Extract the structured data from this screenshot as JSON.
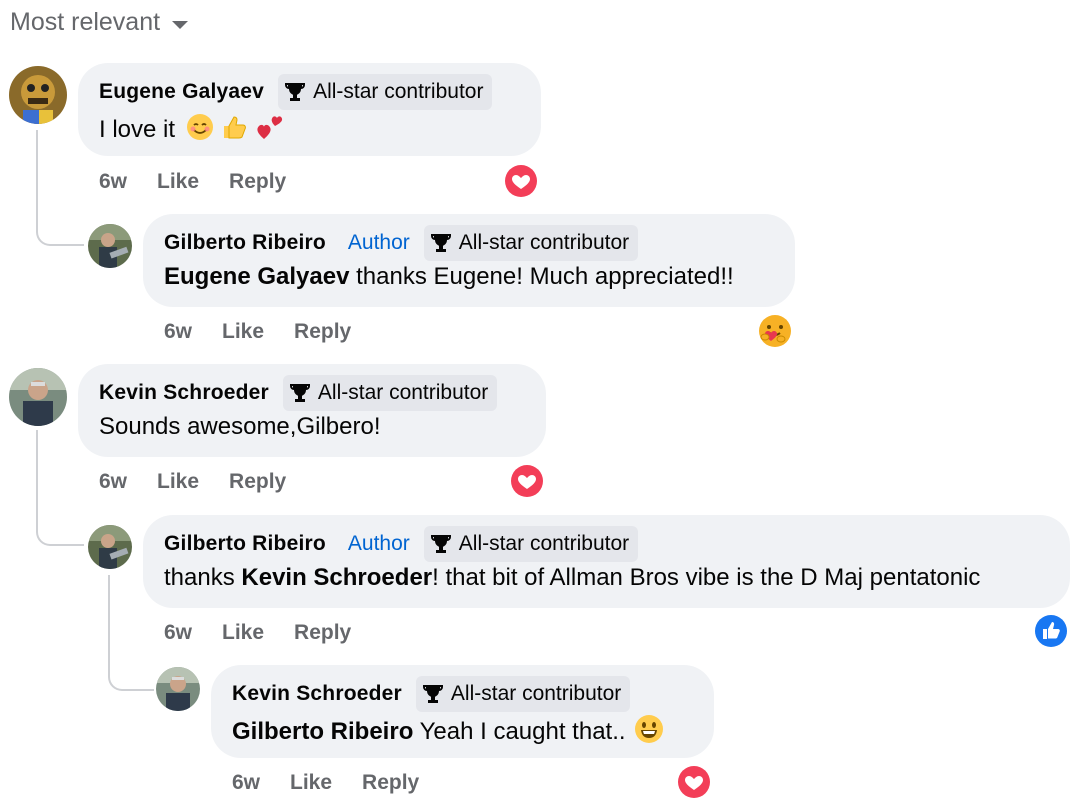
{
  "sort": {
    "label": "Most relevant"
  },
  "comments": [
    {
      "author": "Eugene Galyaev",
      "badge": "All-star contributor",
      "text": "I love it",
      "emojis": [
        "smiling-face-icon",
        "thumbs-up-icon",
        "two-hearts-icon"
      ],
      "time": "6w",
      "like": "Like",
      "reply": "Reply",
      "reaction": "heart-reaction-icon"
    },
    {
      "author": "Gilberto Ribeiro",
      "author_tag": "Author",
      "badge": "All-star contributor",
      "mention": "Eugene Galyaev",
      "text": " thanks Eugene! Much appreciated!!",
      "time": "6w",
      "like": "Like",
      "reply": "Reply",
      "reaction": "hug-reaction-icon"
    },
    {
      "author": "Kevin Schroeder",
      "badge": "All-star contributor",
      "text": "Sounds awesome,Gilbero!",
      "time": "6w",
      "like": "Like",
      "reply": "Reply",
      "reaction": "heart-reaction-icon"
    },
    {
      "author": "Gilberto Ribeiro",
      "author_tag": "Author",
      "badge": "All-star contributor",
      "text_before": "thanks ",
      "mention": "Kevin Schroeder",
      "text": "! that bit of Allman Bros vibe is the D Maj pentatonic",
      "time": "6w",
      "like": "Like",
      "reply": "Reply",
      "reaction": "like-reaction-icon"
    },
    {
      "author": "Kevin Schroeder",
      "badge": "All-star contributor",
      "mention": "Gilberto Ribeiro",
      "text": " Yeah I caught that..",
      "emojis": [
        "grinning-face-icon"
      ],
      "time": "6w",
      "like": "Like",
      "reply": "Reply",
      "reaction": "heart-reaction-icon"
    }
  ],
  "colors": {
    "bubble": "#f0f2f5",
    "badge": "#e4e6eb",
    "author_tag": "#0064d1",
    "heart": "#f33e58",
    "like": "#1877f2",
    "meta": "#65676b"
  }
}
